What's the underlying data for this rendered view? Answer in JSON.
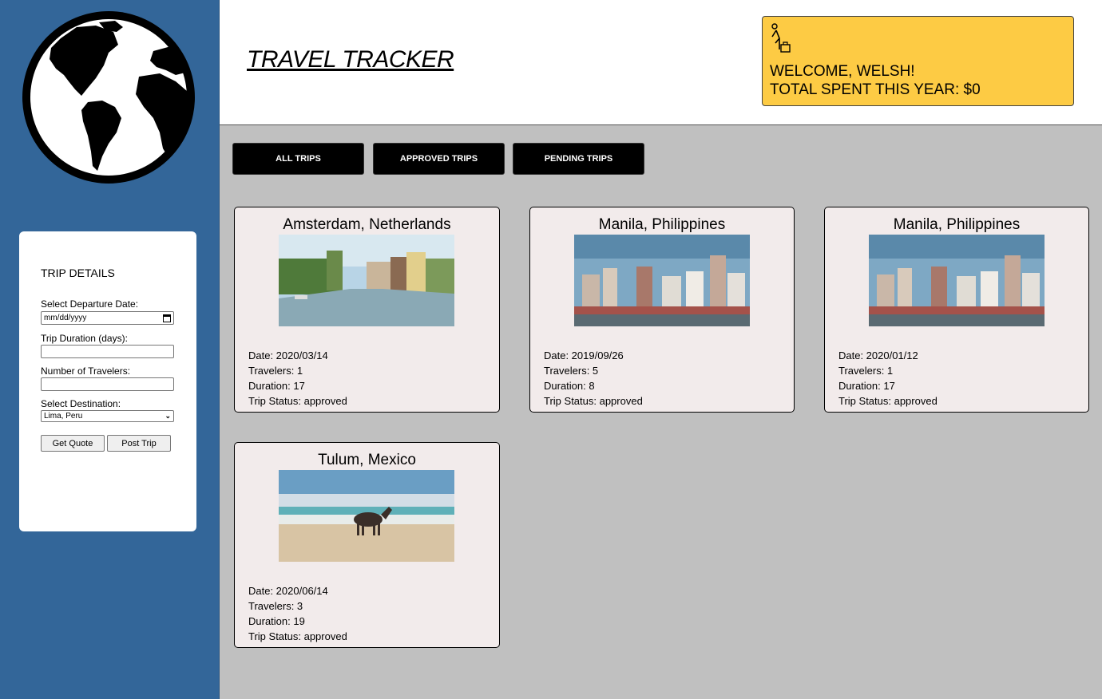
{
  "app": {
    "title": "TRAVEL TRACKER"
  },
  "welcome": {
    "greeting": "WELCOME, WELSH!",
    "spent": "TOTAL SPENT THIS YEAR: $0"
  },
  "form": {
    "title": "TRIP DETAILS",
    "departure_label": "Select Departure Date:",
    "departure_placeholder": "mm/dd/yyyy",
    "duration_label": "Trip Duration (days):",
    "duration_value": "",
    "travelers_label": "Number of Travelers:",
    "travelers_value": "",
    "destination_label": "Select Destination:",
    "destination_value": "Lima, Peru",
    "quote_button": "Get Quote",
    "post_button": "Post Trip"
  },
  "tabs": [
    {
      "label": "ALL TRIPS"
    },
    {
      "label": "APPROVED TRIPS"
    },
    {
      "label": "PENDING TRIPS"
    }
  ],
  "trips": [
    {
      "destination": "Amsterdam, Netherlands",
      "date": "Date: 2020/03/14",
      "travelers": "Travelers: 1",
      "duration": "Duration: 17",
      "status": "Trip Status: approved",
      "image": "amsterdam-canal-photo"
    },
    {
      "destination": "Manila, Philippines",
      "date": "Date: 2019/09/26",
      "travelers": "Travelers: 5",
      "duration": "Duration: 8",
      "status": "Trip Status: approved",
      "image": "manila-skyline-photo"
    },
    {
      "destination": "Manila, Philippines",
      "date": "Date: 2020/01/12",
      "travelers": "Travelers: 1",
      "duration": "Duration: 17",
      "status": "Trip Status: approved",
      "image": "manila-skyline-photo"
    },
    {
      "destination": "Tulum, Mexico",
      "date": "Date: 2020/06/14",
      "travelers": "Travelers: 3",
      "duration": "Duration: 19",
      "status": "Trip Status: approved",
      "image": "tulum-beach-donkey-photo"
    }
  ],
  "colors": {
    "sidebar": "#336699",
    "accent": "#fdcb44",
    "card": "#f2ebeb",
    "background": "#c0c0c0"
  },
  "icons": {
    "logo": "globe-icon",
    "traveler": "traveler-luggage-icon"
  }
}
